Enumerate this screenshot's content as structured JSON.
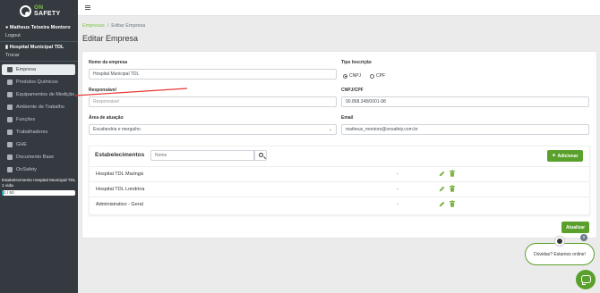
{
  "app": {
    "logo_line1": "ON",
    "logo_line2": "SAFETY"
  },
  "sidebar": {
    "user_name": "Matheus Teixeira Montoro",
    "logout": "Logout",
    "hospital": "Hospital Municipal TDL",
    "trocar": "Trocar",
    "items": [
      {
        "label": "Empresa",
        "icon": "building-icon",
        "active": true
      },
      {
        "label": "Produtos Químicos",
        "icon": "flask-icon",
        "active": false
      },
      {
        "label": "Equipamentos de Medição",
        "icon": "wrench-icon",
        "active": false
      },
      {
        "label": "Ambiente de Trabalho",
        "icon": "layers-icon",
        "active": false
      },
      {
        "label": "Funções",
        "icon": "users-icon",
        "active": false
      },
      {
        "label": "Trabalhadores",
        "icon": "user-group-icon",
        "active": false
      },
      {
        "label": "GHE",
        "icon": "group-icon",
        "active": false
      },
      {
        "label": "Documento Base",
        "icon": "document-icon",
        "active": false
      },
      {
        "label": "OnSafety",
        "icon": "gear-icon",
        "active": false
      }
    ],
    "estab_text": "Estabelecimento Hospital Municipal TDL",
    "vida_text": "1 vida",
    "vida_counter": "1 / 50",
    "vida_fraction": 0.02
  },
  "breadcrumb": {
    "link": "Empresas",
    "separator": "/",
    "current": "Editar Empresa"
  },
  "page_title": "Editar Empresa",
  "form": {
    "nome_label": "Nome da empresa",
    "nome_value": "Hospital Municipal TDL",
    "tipo_label": "Tipo Inscrição",
    "tipo_options": [
      "CNPJ",
      "CPF"
    ],
    "tipo_selected": "CNPJ",
    "responsavel_label": "Responsável",
    "responsavel_placeholder": "Responsável",
    "cnpj_label": "CNPJ/CPF",
    "cnpj_value": "90.868.348/0001-98",
    "area_label": "Área de atuação",
    "area_value": "Escafandria e merguiho",
    "email_label": "Email",
    "email_value": "matheus_montoro@onsafety.com.br"
  },
  "estabelecimentos": {
    "title": "Estabelecimentos",
    "search_placeholder": "Nome",
    "add_label": "Adicionar",
    "rows": [
      {
        "name": "Hospital TDL Maringá",
        "value": "-"
      },
      {
        "name": "Hospital TDL Londrina",
        "value": "-"
      },
      {
        "name": "Administrativo - Geral",
        "value": "-"
      }
    ]
  },
  "update_label": "Atualizar",
  "help": {
    "text": "Dúvidas? Estamos online!",
    "close": "x"
  },
  "colors": {
    "accent": "#5aa02c",
    "sidebar_bg": "#343a40",
    "annotation_line": "#e53935"
  }
}
